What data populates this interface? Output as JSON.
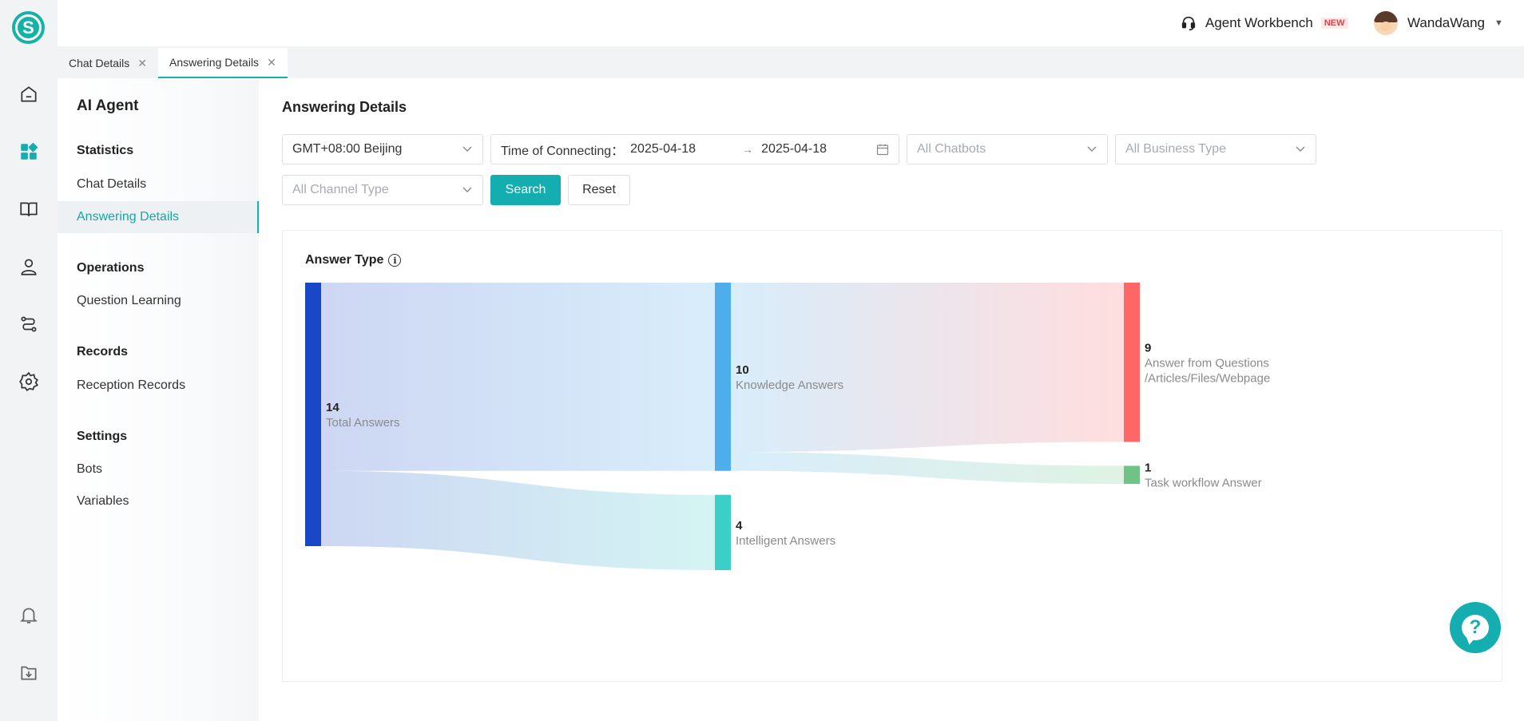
{
  "topbar": {
    "workbench_label": "Agent Workbench",
    "new_badge": "NEW",
    "user_name": "WandaWang"
  },
  "tabs": [
    {
      "label": "Chat Details",
      "active": false
    },
    {
      "label": "Answering Details",
      "active": true
    }
  ],
  "sidenav": {
    "title": "AI Agent",
    "groups": [
      {
        "label": "Statistics",
        "items": [
          "Chat Details",
          "Answering Details"
        ]
      },
      {
        "label": "Operations",
        "items": [
          "Question Learning"
        ]
      },
      {
        "label": "Records",
        "items": [
          "Reception Records"
        ]
      },
      {
        "label": "Settings",
        "items": [
          "Bots",
          "Variables"
        ]
      }
    ],
    "active_item": "Answering Details"
  },
  "main": {
    "title": "Answering Details",
    "filters": {
      "timezone": "GMT+08:00 Beijing",
      "date_label": "Time of Connecting：",
      "date_start": "2025-04-18",
      "date_end": "2025-04-18",
      "date_sep": "→",
      "chatbots_placeholder": "All Chatbots",
      "business_placeholder": "All Business Type",
      "channel_placeholder": "All Channel Type",
      "search_label": "Search",
      "reset_label": "Reset"
    }
  },
  "chart_data": {
    "type": "sankey",
    "title": "Answer Type",
    "nodes": [
      {
        "id": "total",
        "label": "Total Answers",
        "value": 14,
        "color": "#1a47c7"
      },
      {
        "id": "knowledge",
        "label": "Knowledge Answers",
        "value": 10,
        "color": "#4eaeec"
      },
      {
        "id": "intelligent",
        "label": "Intelligent Answers",
        "value": 4,
        "color": "#3ccfc8"
      },
      {
        "id": "qafw",
        "label": "Answer from Questions\n/Articles/Files/Webpage",
        "value": 9,
        "color": "#ff6666"
      },
      {
        "id": "task",
        "label": "Task workflow Answer",
        "value": 1,
        "color": "#6fc485"
      }
    ],
    "links": [
      {
        "source": "total",
        "target": "knowledge",
        "value": 10
      },
      {
        "source": "total",
        "target": "intelligent",
        "value": 4
      },
      {
        "source": "knowledge",
        "target": "qafw",
        "value": 9
      },
      {
        "source": "knowledge",
        "target": "task",
        "value": 1
      }
    ]
  },
  "colors": {
    "accent": "#14adb0",
    "active_text": "#14a8a0"
  }
}
